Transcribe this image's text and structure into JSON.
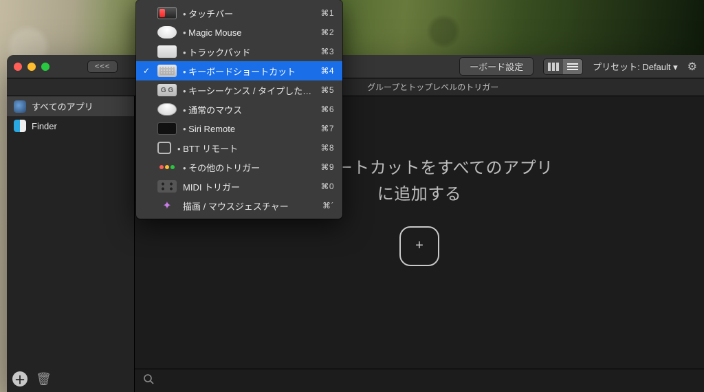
{
  "titlebar": {
    "back_label": "<<<",
    "center_button_label": "ーボード設定",
    "preset_label": "プリセット: Default",
    "preset_caret": "▾"
  },
  "subheader": {
    "text": "グループとトップレベルのトリガー"
  },
  "sidebar": {
    "items": [
      {
        "label": "すべてのアプリ",
        "selected": true
      },
      {
        "label": "Finder",
        "selected": false
      }
    ]
  },
  "main": {
    "message_line1": "ドショートカットをすべてのアプリ",
    "message_line2": "に追加する",
    "add_glyph": "+"
  },
  "dropdown": {
    "items": [
      {
        "label": "タッチバー",
        "shortcut": "⌘1",
        "checked": false,
        "nodot": false
      },
      {
        "label": "Magic Mouse",
        "shortcut": "⌘2",
        "checked": false,
        "nodot": false
      },
      {
        "label": "トラックパッド",
        "shortcut": "⌘3",
        "checked": false,
        "nodot": false
      },
      {
        "label": "キーボードショートカット",
        "shortcut": "⌘4",
        "checked": true,
        "nodot": false
      },
      {
        "label": "キーシーケンス / タイプした単語",
        "shortcut": "⌘5",
        "checked": false,
        "nodot": false
      },
      {
        "label": "通常のマウス",
        "shortcut": "⌘6",
        "checked": false,
        "nodot": false
      },
      {
        "label": "Siri Remote",
        "shortcut": "⌘7",
        "checked": false,
        "nodot": false
      },
      {
        "label": "BTT リモート",
        "shortcut": "⌘8",
        "checked": false,
        "nodot": false
      },
      {
        "label": "その他のトリガー",
        "shortcut": "⌘9",
        "checked": false,
        "nodot": false
      },
      {
        "label": "MIDI トリガー",
        "shortcut": "⌘0",
        "checked": false,
        "nodot": true
      },
      {
        "label": "描画 / マウスジェスチャー",
        "shortcut": "⌘´",
        "checked": false,
        "nodot": true
      }
    ]
  }
}
